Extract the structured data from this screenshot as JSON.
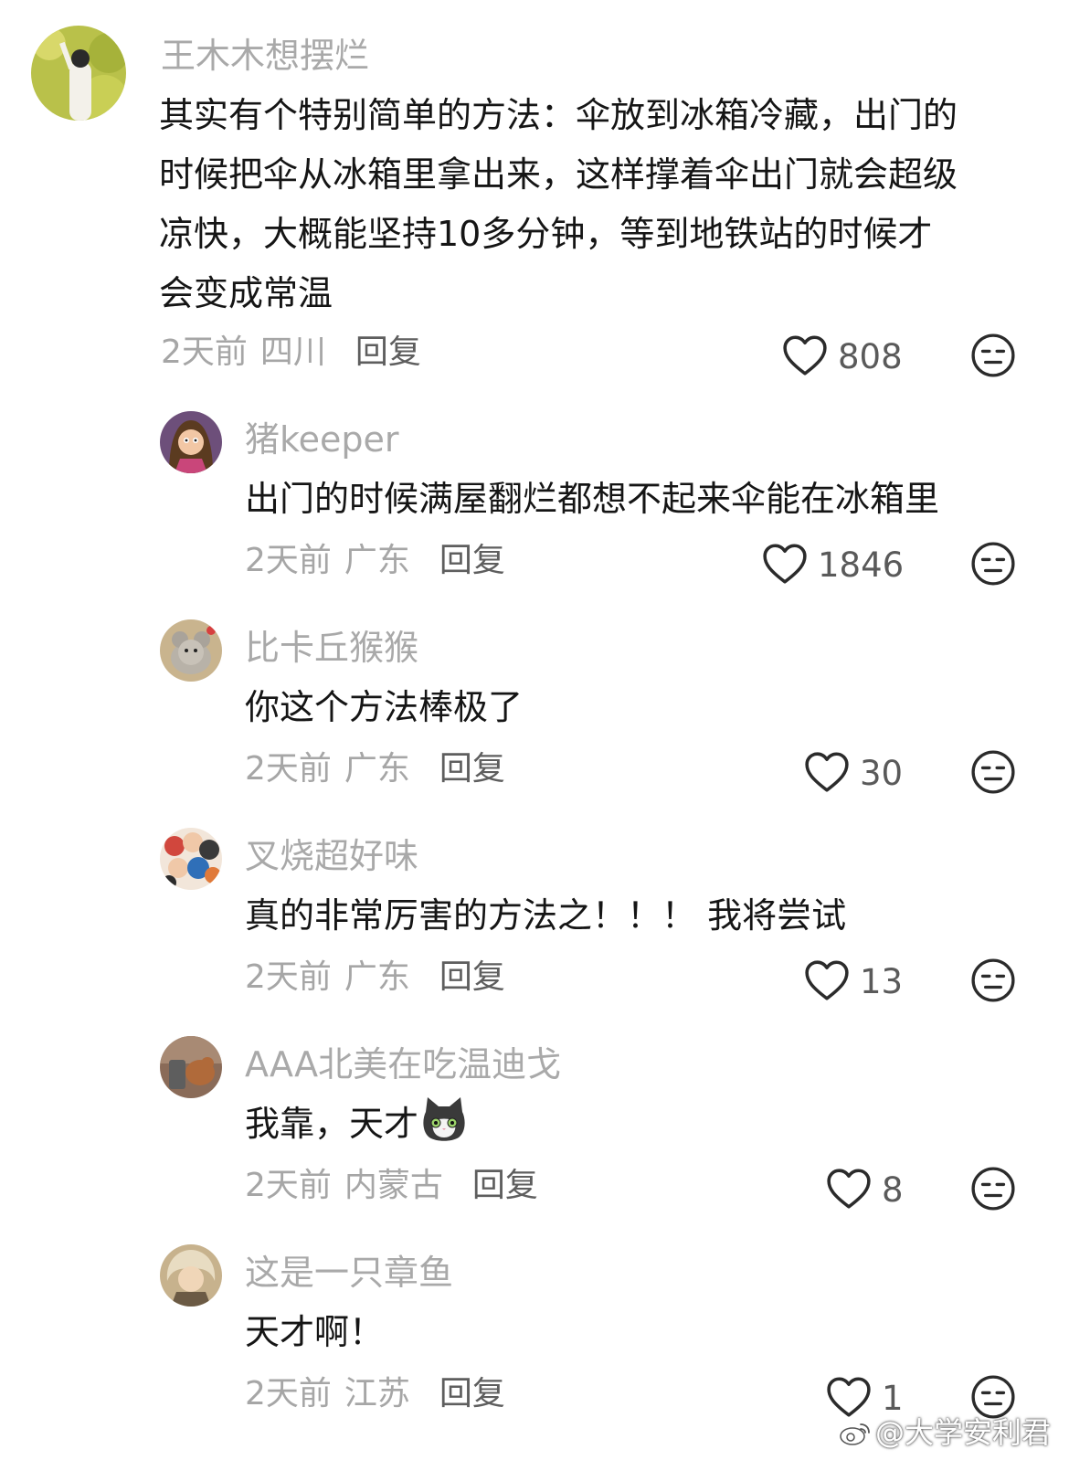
{
  "comments": [
    {
      "username": "王木木想摆烂",
      "text_lines": [
        "其实有个特别简单的方法：伞放到冰箱冷藏，出门的",
        "时候把伞从冰箱里拿出来，这样撑着伞出门就会超级",
        "凉快，大概能坚持10多分钟，等到地铁站的时候才",
        "会变成常温"
      ],
      "time": "2天前",
      "location": "四川",
      "reply_label": "回复",
      "likes": "808",
      "avatar_color": "#b9c14a"
    },
    {
      "username": "猪keeper",
      "text_lines": [
        "出门的时候满屋翻烂都想不起来伞能在冰箱里"
      ],
      "time": "2天前",
      "location": "广东",
      "reply_label": "回复",
      "likes": "1846",
      "avatar_color": "#6d4f7a"
    },
    {
      "username": "比卡丘猴猴",
      "text_lines": [
        "你这个方法棒极了"
      ],
      "time": "2天前",
      "location": "广东",
      "reply_label": "回复",
      "likes": "30",
      "avatar_color": "#c9b48e"
    },
    {
      "username": "叉烧超好味",
      "text_lines": [
        "真的非常厉害的方法之！！！ 我将尝试"
      ],
      "time": "2天前",
      "location": "广东",
      "reply_label": "回复",
      "likes": "13",
      "avatar_color": "#d1473d"
    },
    {
      "username": "AAA北美在吃温迪戈",
      "text_lines": [
        "我靠，天才"
      ],
      "text_emoji": "cat-face-emoji",
      "time": "2天前",
      "location": "内蒙古",
      "reply_label": "回复",
      "likes": "8",
      "avatar_color": "#8a6b58"
    },
    {
      "username": "这是一只章鱼",
      "text_lines": [
        "天才啊！"
      ],
      "time": "2天前",
      "location": "江苏",
      "reply_label": "回复",
      "likes": "1",
      "avatar_color": "#c7b28d"
    }
  ],
  "watermark": "@大学安利君",
  "icons": {
    "like": "heart-outline-icon",
    "dislike": "meh-face-icon"
  },
  "colors": {
    "username": "#a9a9a9",
    "meta": "#a6a6a6",
    "text": "#151515"
  }
}
